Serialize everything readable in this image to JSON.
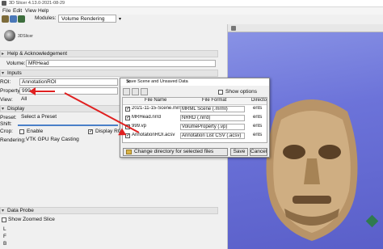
{
  "window": {
    "title": "3D Slicer 4.13.0-2021-08-29"
  },
  "menu": [
    "File",
    "Edit",
    "View",
    "Help"
  ],
  "toolbar": {
    "modules_label": "Modules:",
    "module_selected": "Volume Rendering"
  },
  "logo": {
    "text": "3DSlicer"
  },
  "sections": {
    "help": "Help & Acknowledgement",
    "inputs": "Inputs",
    "display": "Display",
    "data_probe": "Data Probe"
  },
  "volume": {
    "label": "Volume:",
    "value": "MRHead"
  },
  "roi": {
    "label": "ROI:",
    "value": "AnnotationROI"
  },
  "property": {
    "label": "Property:",
    "value": "999"
  },
  "view": {
    "label": "View:",
    "value": "All"
  },
  "preset": {
    "label": "Preset:",
    "value": "Select a Preset"
  },
  "shift": {
    "label": "Shift:"
  },
  "crop": {
    "label": "Crop:",
    "enable": "Enable",
    "display_roi": "Display RO"
  },
  "rendering": {
    "label": "Rendering:",
    "value": "VTK GPU Ray Casting"
  },
  "probe": {
    "show_zoomed": "Show Zoomed Slice",
    "letters": [
      "L",
      "F",
      "B"
    ]
  },
  "dialog": {
    "title": "Save Scene and Unsaved Data",
    "show_options": "Show options",
    "columns": [
      "File Name",
      "File Format",
      "Directory"
    ],
    "rows": [
      {
        "checked": true,
        "name": "2021-11-15-Scene.mrml",
        "format": "MRML Scene (.mrml)",
        "dir": "ents"
      },
      {
        "checked": true,
        "name": "MRHead.nrrd",
        "format": "NRRD (.nrrd)",
        "dir": "ents"
      },
      {
        "checked": true,
        "name": "999.vp",
        "format": "VolumeProperty (.vp)",
        "dir": "ents"
      },
      {
        "checked": true,
        "name": "AnnotationROI.acsv",
        "format": "Annotation List CSV (.acsv)",
        "dir": "ents"
      }
    ],
    "change_dir": "Change directory for selected files",
    "save": "Save",
    "cancel": "Cancel"
  },
  "colors": {
    "viewer_bg": "#6c73d9",
    "annotation_red": "#e02020",
    "skin": "#c9a57a"
  }
}
